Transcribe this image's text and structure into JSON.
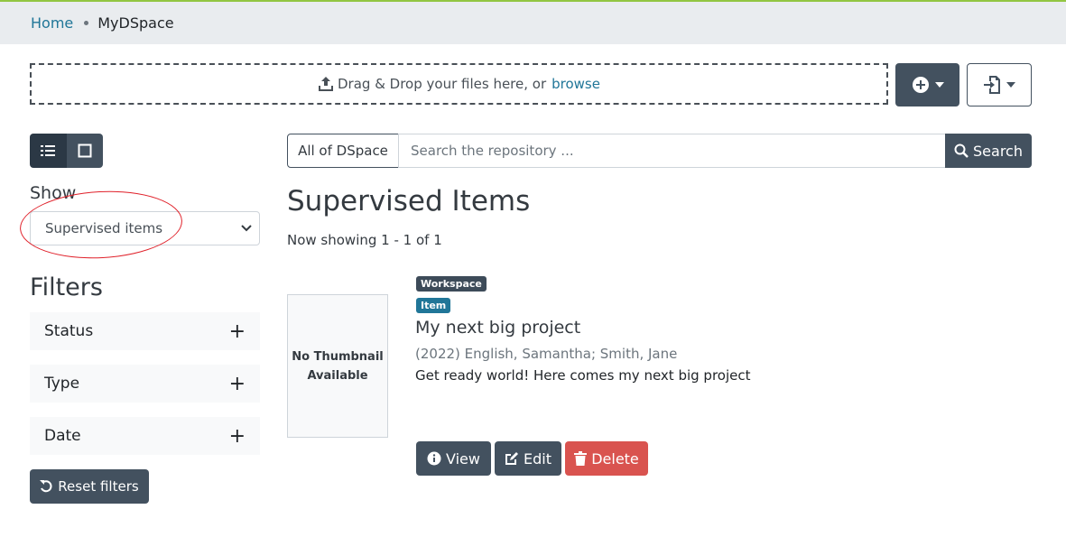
{
  "breadcrumb": {
    "home": "Home",
    "current": "MyDSpace"
  },
  "upload": {
    "text": "Drag & Drop your files here, or",
    "browse": "browse"
  },
  "sidebar": {
    "show_label": "Show",
    "show_selected": "Supervised items",
    "filters_title": "Filters",
    "facets": [
      {
        "label": "Status"
      },
      {
        "label": "Type"
      },
      {
        "label": "Date"
      }
    ],
    "reset_label": "Reset filters"
  },
  "search": {
    "scope": "All of DSpace",
    "placeholder": "Search the repository ...",
    "button": "Search"
  },
  "main": {
    "title": "Supervised Items",
    "showing": "Now showing 1 - 1 of 1"
  },
  "result": {
    "thumbnail_line1": "No Thumbnail",
    "thumbnail_line2": "Available",
    "badge_workspace": "Workspace",
    "badge_type": "Item",
    "title": "My next big project",
    "meta": "(2022) English, Samantha; Smith, Jane",
    "abstract": "Get ready world! Here comes my next big project",
    "actions": {
      "view": "View",
      "edit": "Edit",
      "delete": "Delete"
    }
  },
  "colors": {
    "primary": "#43515f",
    "link": "#207698",
    "danger": "#d9534f",
    "accent_line": "#92c642",
    "annotation": "#e0212a"
  }
}
